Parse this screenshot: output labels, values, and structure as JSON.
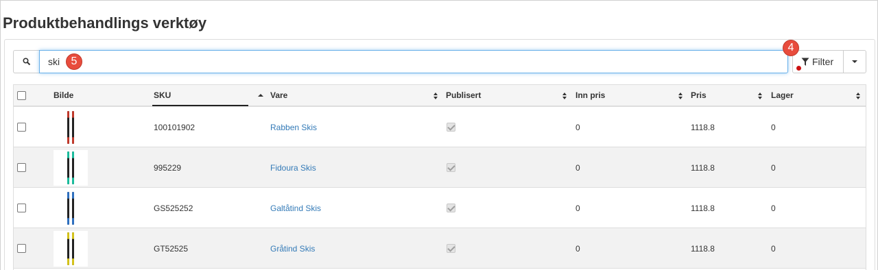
{
  "page": {
    "title": "Produktbehandlings verktøy"
  },
  "search": {
    "value": "ski",
    "badge": "5"
  },
  "filter": {
    "label": "Filter",
    "badge": "4",
    "badge_color": "#e84c3d",
    "active_dot_color": "#cc1111"
  },
  "table": {
    "columns": [
      "Bilde",
      "SKU",
      "Vare",
      "Publisert",
      "Inn pris",
      "Pris",
      "Lager"
    ],
    "sorted_by": "SKU",
    "rows": [
      {
        "sku": "100101902",
        "vare": "Rabben Skis",
        "publisert": true,
        "inn_pris": "0",
        "pris": "1118.8",
        "lager": "0",
        "ski_color": "#c0392b"
      },
      {
        "sku": "995229",
        "vare": "Fidoura Skis",
        "publisert": true,
        "inn_pris": "0",
        "pris": "1118.8",
        "lager": "0",
        "ski_color": "#1abc9c"
      },
      {
        "sku": "GS525252",
        "vare": "Galtåtind Skis",
        "publisert": true,
        "inn_pris": "0",
        "pris": "1118.8",
        "lager": "0",
        "ski_color": "#2e6fbf"
      },
      {
        "sku": "GT52525",
        "vare": "Gråtind Skis",
        "publisert": true,
        "inn_pris": "0",
        "pris": "1118.8",
        "lager": "0",
        "ski_color": "#d4c21a"
      }
    ]
  },
  "colors": {
    "link": "#337ab7",
    "focus_border": "#66afe9",
    "header_bg": "#f5f5f5",
    "alt_row_bg": "#f2f2f2"
  }
}
